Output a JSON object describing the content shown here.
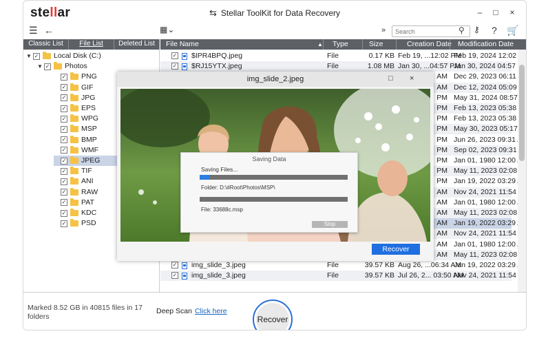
{
  "app": {
    "logo": "stellar",
    "window_title": "Stellar ToolKit for Data Recovery",
    "window_controls": [
      "–",
      "□",
      "×"
    ]
  },
  "toolbar": {
    "search_placeholder": "Search",
    "icons": [
      "menu-icon",
      "back-icon",
      "view-grid-icon",
      "expand-icon",
      "search-icon",
      "key-icon",
      "help-icon",
      "cart-icon"
    ]
  },
  "tabs": [
    "Classic List",
    "File List",
    "Deleted List"
  ],
  "tree": [
    {
      "label": "Local Disk (C:)",
      "level": 0,
      "caret": "▼"
    },
    {
      "label": "Photos",
      "level": 1,
      "caret": "▼"
    },
    {
      "label": "PNG",
      "level": 2
    },
    {
      "label": "GIF",
      "level": 2
    },
    {
      "label": "JPG",
      "level": 2
    },
    {
      "label": "EPS",
      "level": 2
    },
    {
      "label": "WPG",
      "level": 2
    },
    {
      "label": "MSP",
      "level": 2
    },
    {
      "label": "BMP",
      "level": 2
    },
    {
      "label": "WMF",
      "level": 2
    },
    {
      "label": "JPEG",
      "level": 2,
      "selected": true
    },
    {
      "label": "TIF",
      "level": 2
    },
    {
      "label": "ANI",
      "level": 2
    },
    {
      "label": "RAW",
      "level": 2
    },
    {
      "label": "PAT",
      "level": 2
    },
    {
      "label": "KDC",
      "level": 2
    },
    {
      "label": "PSD",
      "level": 2
    }
  ],
  "columns": [
    "File Name",
    "Type",
    "Size",
    "Creation Date",
    "Modification Date"
  ],
  "rows": [
    {
      "name": "$IPR4BPQ.jpeg",
      "type": "File",
      "size": "0.17 KB",
      "created": "Feb 19, ...12:02 PM",
      "modified": "Feb 19, 2024 12:02 PM"
    },
    {
      "name": "$RJ15YTX.jpeg",
      "type": "File",
      "size": "1.08 MB",
      "created": "Jan 30, ...04:57 PM",
      "modified": "Jan 30, 2024 04:57 PM"
    },
    {
      "name": "",
      "type": "",
      "size": "",
      "created": "AM",
      "modified": "Dec 29, 2023 06:11 AM"
    },
    {
      "name": "",
      "type": "",
      "size": "",
      "created": "AM",
      "modified": "Dec 12, 2024 05:09 AM"
    },
    {
      "name": "",
      "type": "",
      "size": "",
      "created": "PM",
      "modified": "May 31, 2024 08:57 AM"
    },
    {
      "name": "",
      "type": "",
      "size": "",
      "created": "PM",
      "modified": "Feb 13, 2023 05:38 AM"
    },
    {
      "name": "",
      "type": "",
      "size": "",
      "created": "PM",
      "modified": "Feb 13, 2023 05:38 AM"
    },
    {
      "name": "",
      "type": "",
      "size": "",
      "created": "PM",
      "modified": "May 30, 2023 05:17 AM"
    },
    {
      "name": "",
      "type": "",
      "size": "",
      "created": "PM",
      "modified": "Jun 26, 2023 09:31 AM"
    },
    {
      "name": "",
      "type": "",
      "size": "",
      "created": "PM",
      "modified": "Sep 02, 2023 09:31 AM"
    },
    {
      "name": "",
      "type": "",
      "size": "",
      "created": "PM",
      "modified": "Jan 01, 1980 12:00 AM"
    },
    {
      "name": "",
      "type": "",
      "size": "",
      "created": "PM",
      "modified": "May 11, 2023 02:08 AM"
    },
    {
      "name": "",
      "type": "",
      "size": "",
      "created": "PM",
      "modified": "Jan 19, 2022 03:29 AM"
    },
    {
      "name": "",
      "type": "",
      "size": "",
      "created": "AM",
      "modified": "Nov 24, 2021 11:54 PM"
    },
    {
      "name": "",
      "type": "",
      "size": "",
      "created": "AM",
      "modified": "Jan 01, 1980 12:00 AM"
    },
    {
      "name": "",
      "type": "",
      "size": "",
      "created": "AM",
      "modified": "May 11, 2023 02:08 AM"
    },
    {
      "name": "",
      "type": "",
      "size": "",
      "created": "AM",
      "modified": "Jan 19, 2022 03:29 AM",
      "highlight": true
    },
    {
      "name": "",
      "type": "",
      "size": "",
      "created": "AM",
      "modified": "Nov 24, 2021 11:54 PM"
    },
    {
      "name": "",
      "type": "",
      "size": "",
      "created": "AM",
      "modified": "Jan 01, 1980 12:00 AM"
    },
    {
      "name": "",
      "type": "",
      "size": "",
      "created": "AM",
      "modified": "May 11, 2023 02:08 AM"
    },
    {
      "name": "img_slide_3.jpeg",
      "type": "File",
      "size": "39.57 KB",
      "created": "Aug 26, ...06:34 AM",
      "modified": "Jan 19, 2022 03:29 AM"
    },
    {
      "name": "img_slide_3.jpeg",
      "type": "File",
      "size": "39.57 KB",
      "created": "Jul 26, 2... 03:50 AM",
      "modified": "Nov 24, 2021 11:54 PM"
    }
  ],
  "status": {
    "marked": "Marked 8.52 GB in 40815 files in 17 folders",
    "deep_scan_label": "Deep Scan",
    "deep_scan_link": "Click here",
    "recover_button": "Recover"
  },
  "preview": {
    "title": "img_slide_2.jpeg",
    "controls": [
      "□",
      "×"
    ],
    "recover_button": "Recover"
  },
  "saving": {
    "title": "Saving Data",
    "label": "Saving Files...",
    "folder": "Folder: D:\\#Root\\Photos\\MSP\\",
    "file": "File: 33688c.msp",
    "stop": "Stop",
    "progress_primary": 0.07,
    "progress_secondary": 1.0
  },
  "colors": {
    "header_bg": "#5d6166",
    "accent_blue": "#1f6fe0",
    "logo_red": "#e53935",
    "selection": "#c9d4e6"
  }
}
